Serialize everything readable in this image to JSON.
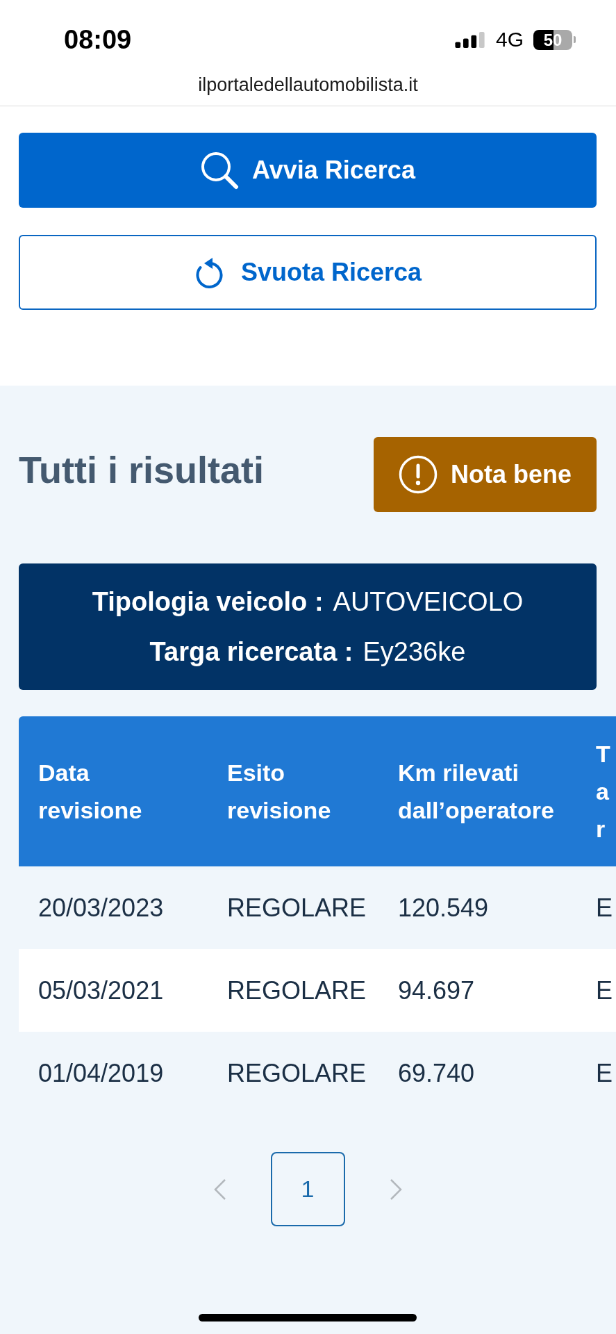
{
  "status_bar": {
    "time": "08:09",
    "network": "4G",
    "battery": "50"
  },
  "browser": {
    "url": "ilportaledellautomobilista.it"
  },
  "actions": [
    {
      "label": "Avvia Ricerca",
      "kind": "primary"
    },
    {
      "label": "Svuota Ricerca",
      "kind": "secondary"
    }
  ],
  "results": {
    "title": "Tutti i risultati",
    "notice_button": "Nota bene"
  },
  "vehicle": [
    {
      "label": "Tipologia veicolo :",
      "value": "AUTOVEICOLO"
    },
    {
      "label": "Targa ricercata :",
      "value": "Ey236ke"
    }
  ],
  "table": {
    "columns": [
      "Data revisione",
      "Esito revisione",
      "Km rilevati dall’operatore",
      "T a r"
    ],
    "rows": [
      [
        "20/03/2023",
        "REGOLARE",
        "120.549",
        "E"
      ],
      [
        "05/03/2021",
        "REGOLARE",
        "94.697",
        "E"
      ],
      [
        "01/04/2019",
        "REGOLARE",
        "69.740",
        "E"
      ]
    ]
  },
  "pagination": {
    "previous": {
      "disabled": true
    },
    "pages": [
      {
        "label": "1",
        "selected": true
      }
    ],
    "next": {
      "disabled": true
    }
  }
}
